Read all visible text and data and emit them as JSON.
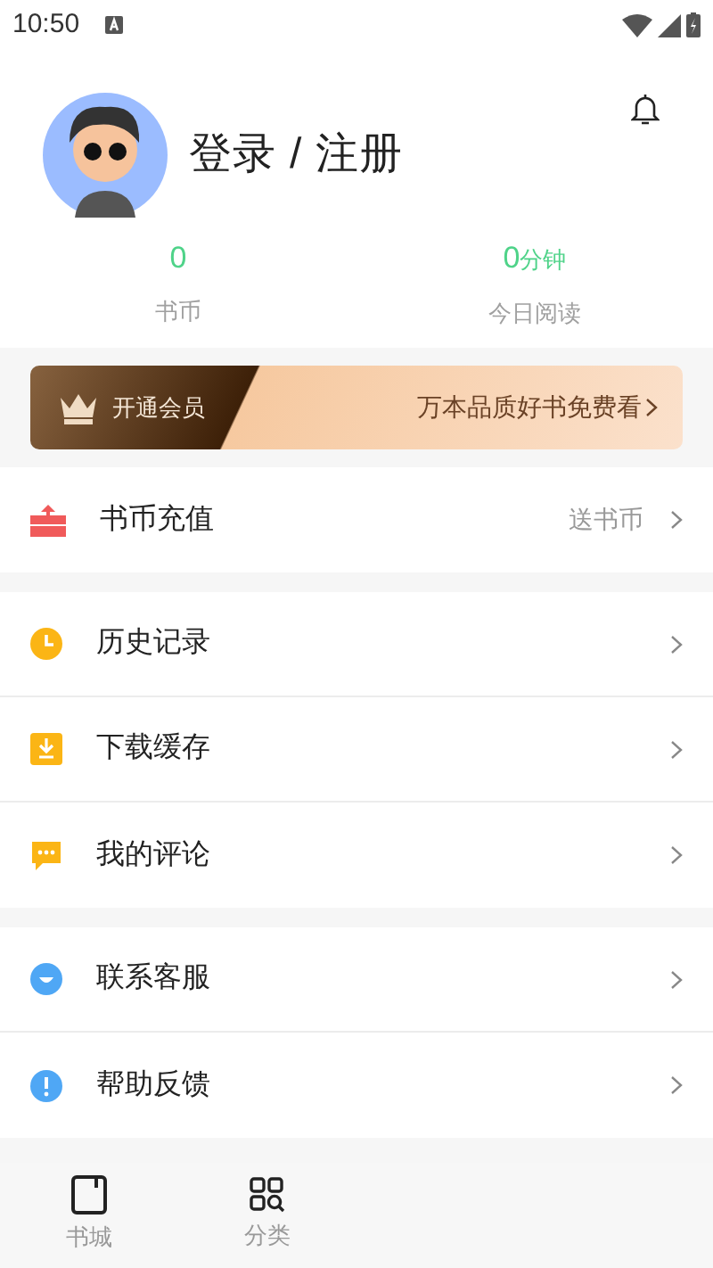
{
  "status_bar": {
    "time": "10:50"
  },
  "profile": {
    "title": "登录 / 注册"
  },
  "stats": [
    {
      "value": "0",
      "label": "书币"
    },
    {
      "value": "0",
      "unit": "分钟",
      "label": "今日阅读"
    }
  ],
  "vip_banner": {
    "label": "开通会员",
    "promo": "万本品质好书免费看"
  },
  "menu_groups": [
    [
      {
        "kind": "recharge",
        "label": "书币充值",
        "detail": "送书币"
      }
    ],
    [
      {
        "kind": "history",
        "label": "历史记录"
      },
      {
        "kind": "download",
        "label": "下载缓存"
      },
      {
        "kind": "comment",
        "label": "我的评论"
      }
    ],
    [
      {
        "kind": "service",
        "label": "联系客服"
      },
      {
        "kind": "feedback",
        "label": "帮助反馈"
      }
    ]
  ],
  "bottom_nav": [
    {
      "kind": "bookstore",
      "label": "书城"
    },
    {
      "kind": "category",
      "label": "分类"
    }
  ]
}
